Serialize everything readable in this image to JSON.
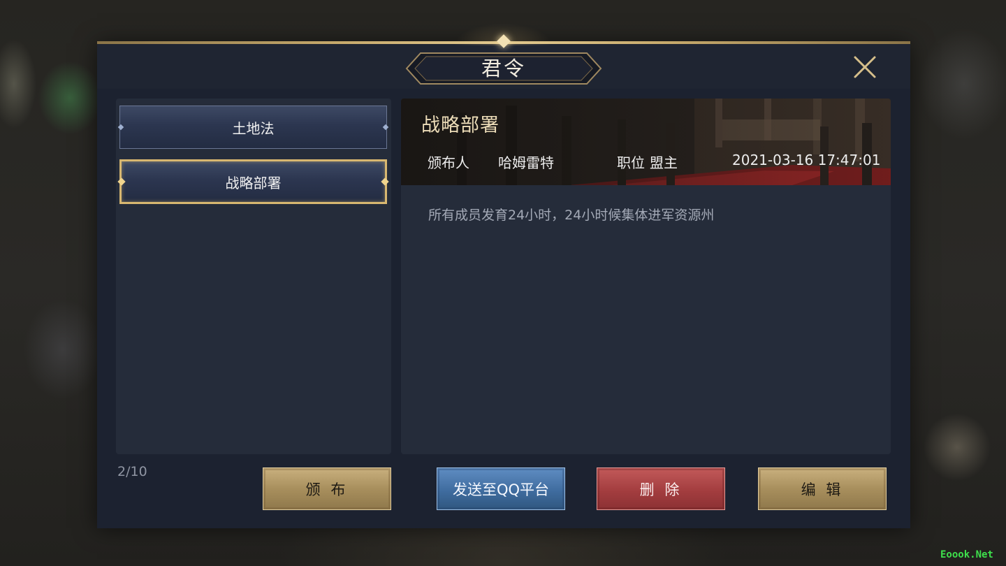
{
  "window": {
    "title": "君令"
  },
  "laws": [
    {
      "label": "土地法",
      "selected": false
    },
    {
      "label": "战略部署",
      "selected": true
    }
  ],
  "detail": {
    "title": "战略部署",
    "publisher_label": "颁布人",
    "publisher_name": "哈姆雷特",
    "position_label": "职位",
    "position_value": "盟主",
    "timestamp": "2021-03-16 17:47:01",
    "body": "所有成员发育24小时，24小时候集体进军资源州"
  },
  "pagination": {
    "count": "2/10"
  },
  "buttons": {
    "publish": "颁 布",
    "send_qq": "发送至QQ平台",
    "delete": "删 除",
    "edit": "编 辑"
  },
  "watermark": "Eoook.Net",
  "icons": {
    "close": "close-icon"
  },
  "colors": {
    "panel": "#1c2230",
    "gold_accent": "#d8b770",
    "title_gold": "#ecdcb8",
    "button_gold": "#a88f5d",
    "button_blue": "#3f6c9f",
    "button_red": "#a33d3f"
  }
}
